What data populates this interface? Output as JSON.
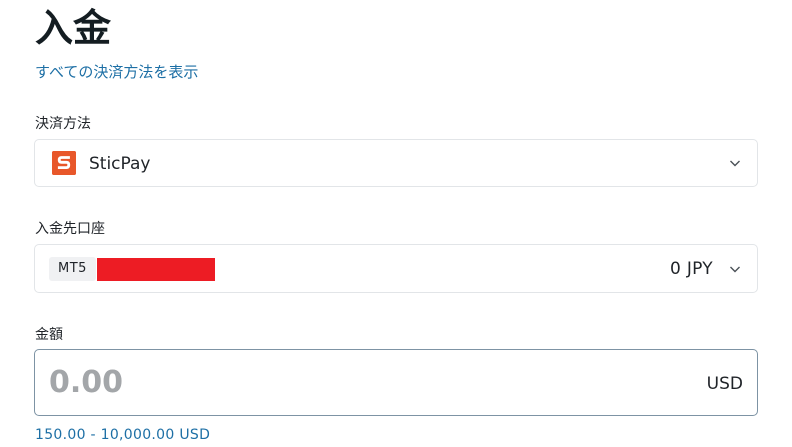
{
  "page": {
    "title": "入金",
    "show_all_methods_link": "すべての決済方法を表示"
  },
  "payment_method": {
    "label": "決済方法",
    "selected": "SticPay",
    "icon": "sticpay-logo-icon",
    "icon_color": "#e8572a"
  },
  "deposit_account": {
    "label": "入金先口座",
    "account_type": "MT5",
    "account_number_redacted": true,
    "balance": "0 JPY"
  },
  "amount": {
    "label": "金額",
    "placeholder": "0.00",
    "value": "",
    "currency": "USD",
    "range_hint": "150.00 - 10,000.00 USD"
  },
  "colors": {
    "link": "#1d6fa5",
    "redaction": "#ed1c24",
    "input_border_focus": "#7d93a4"
  }
}
